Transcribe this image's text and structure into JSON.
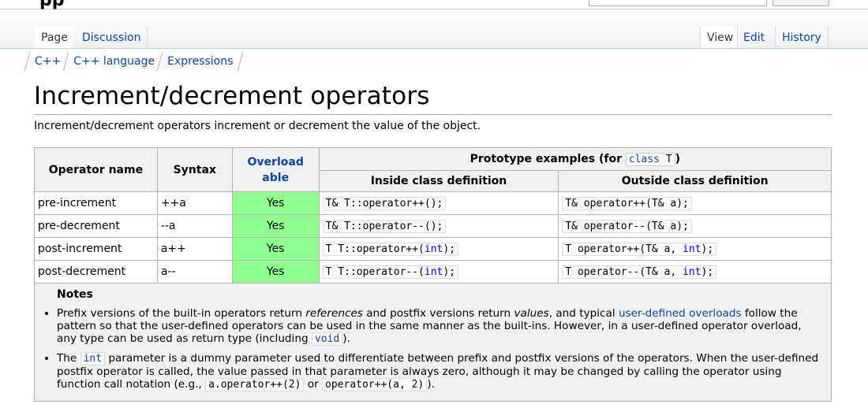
{
  "header": {
    "logo_fragment": "pp"
  },
  "tabs": {
    "left": [
      {
        "label": "Page"
      },
      {
        "label": "Discussion"
      }
    ],
    "right": [
      {
        "label": "View"
      },
      {
        "label": "Edit"
      },
      {
        "label": "History"
      }
    ]
  },
  "breadcrumb": [
    "C++",
    "C++ language",
    "Expressions"
  ],
  "title": "Increment/decrement operators",
  "intro": "Increment/decrement operators increment or decrement the value of the object.",
  "table": {
    "headers": {
      "operator_name": "Operator name",
      "syntax": "Syntax",
      "overloadable": "Overload able",
      "prototype_prefix": "Prototype examples (for ",
      "prototype_code_kw": "class",
      "prototype_code_t": " T",
      "prototype_suffix": ")",
      "inside": "Inside class definition",
      "outside": "Outside class definition"
    },
    "rows": [
      {
        "name": "pre-increment",
        "syntax": "++a",
        "overloadable": "Yes",
        "inside": "T& T::operator++();",
        "outside": "T& operator++(T& a);"
      },
      {
        "name": "pre-decrement",
        "syntax": "--a",
        "overloadable": "Yes",
        "inside": "T& T::operator--();",
        "outside": "T& operator--(T& a);"
      },
      {
        "name": "post-increment",
        "syntax": "a++",
        "overloadable": "Yes",
        "inside_pre": "T T::operator++(",
        "inside_kw": "int",
        "inside_post": ");",
        "outside_pre": "T operator++(T& a, ",
        "outside_kw": "int",
        "outside_post": ");"
      },
      {
        "name": "post-decrement",
        "syntax": "a--",
        "overloadable": "Yes",
        "inside_pre": "T T::operator--(",
        "inside_kw": "int",
        "inside_post": ");",
        "outside_pre": "T operator--(T& a, ",
        "outside_kw": "int",
        "outside_post": ");"
      }
    ]
  },
  "notes": {
    "title": "Notes",
    "n1": {
      "t1": "Prefix versions of the built-in operators return ",
      "em1": "references",
      "t2": " and postfix versions return ",
      "em2": "values",
      "t3": ", and typical ",
      "link1": "user-defined overloads",
      "t4": " follow the pattern so that the user-defined operators can be used in the same manner as the built-ins. However, in a user-defined operator overload, any type can be used as return type (including ",
      "code": "void",
      "t5": ")."
    },
    "n2": {
      "t1": "The ",
      "code1": "int",
      "t2": " parameter is a dummy parameter used to differentiate between prefix and postfix versions of the operators. When the user-defined postfix operator is called, the value passed in that parameter is always zero, although it may be changed by calling the operator using function call notation (e.g., ",
      "code2": "a.operator++(2)",
      "t3": " or ",
      "code3": "operator++(a, 2)",
      "t4": ")."
    }
  },
  "colors": {
    "link": "#0645ad",
    "yes_bg": "#90ff90",
    "header_bg": "#f1f1f1"
  }
}
